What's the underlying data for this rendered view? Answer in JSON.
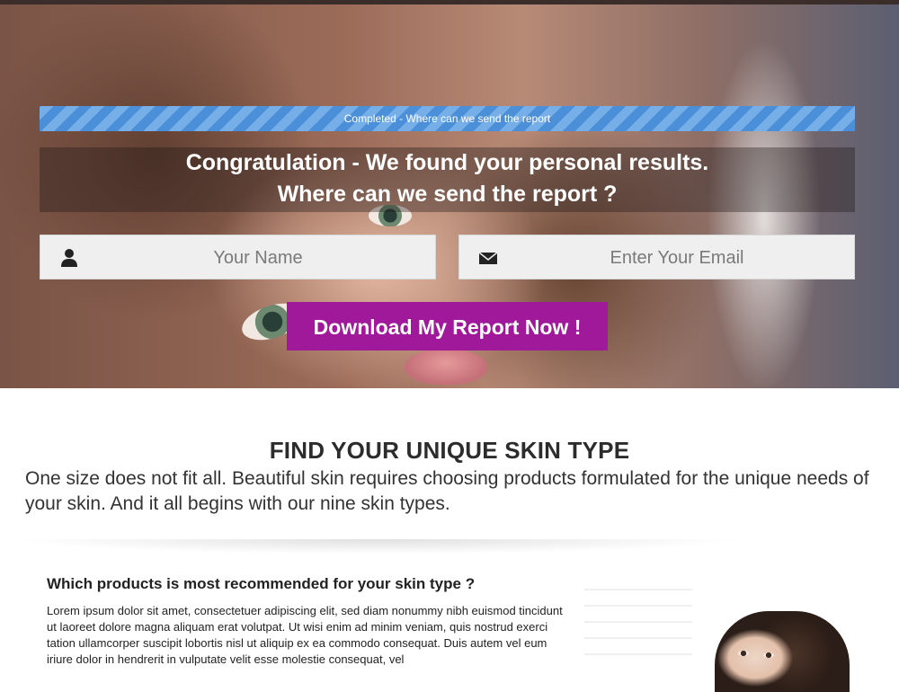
{
  "progress": {
    "label": "Completed - Where can we send the report"
  },
  "headline": {
    "line1": "Congratulation - We found your personal results.",
    "line2": "Where can we send the report ?"
  },
  "form": {
    "name_placeholder": "Your Name",
    "name_icon": "user-icon",
    "email_placeholder": "Enter Your Email",
    "email_icon": "envelope-icon",
    "submit_label": "Download My Report Now !"
  },
  "section": {
    "title": "FIND YOUR UNIQUE SKIN TYPE",
    "description": "One size does not fit all. Beautiful skin requires choosing products formulated for the unique needs of your skin. And it all begins with our nine skin types."
  },
  "content": {
    "heading": "Which products is most recommended for your skin type ?",
    "body": "Lorem ipsum dolor sit amet, consectetuer adipiscing elit, sed diam nonummy nibh euismod tincidunt ut laoreet dolore magna aliquam erat volutpat. Ut wisi enim ad minim veniam, quis nostrud exerci tation ullamcorper suscipit lobortis nisl ut aliquip ex ea commodo consequat. Duis autem vel eum iriure dolor in hendrerit in vulputate velit esse molestie consequat, vel"
  },
  "colors": {
    "progress_blue": "#4a8fd8",
    "cta_purple": "#a0199b"
  }
}
